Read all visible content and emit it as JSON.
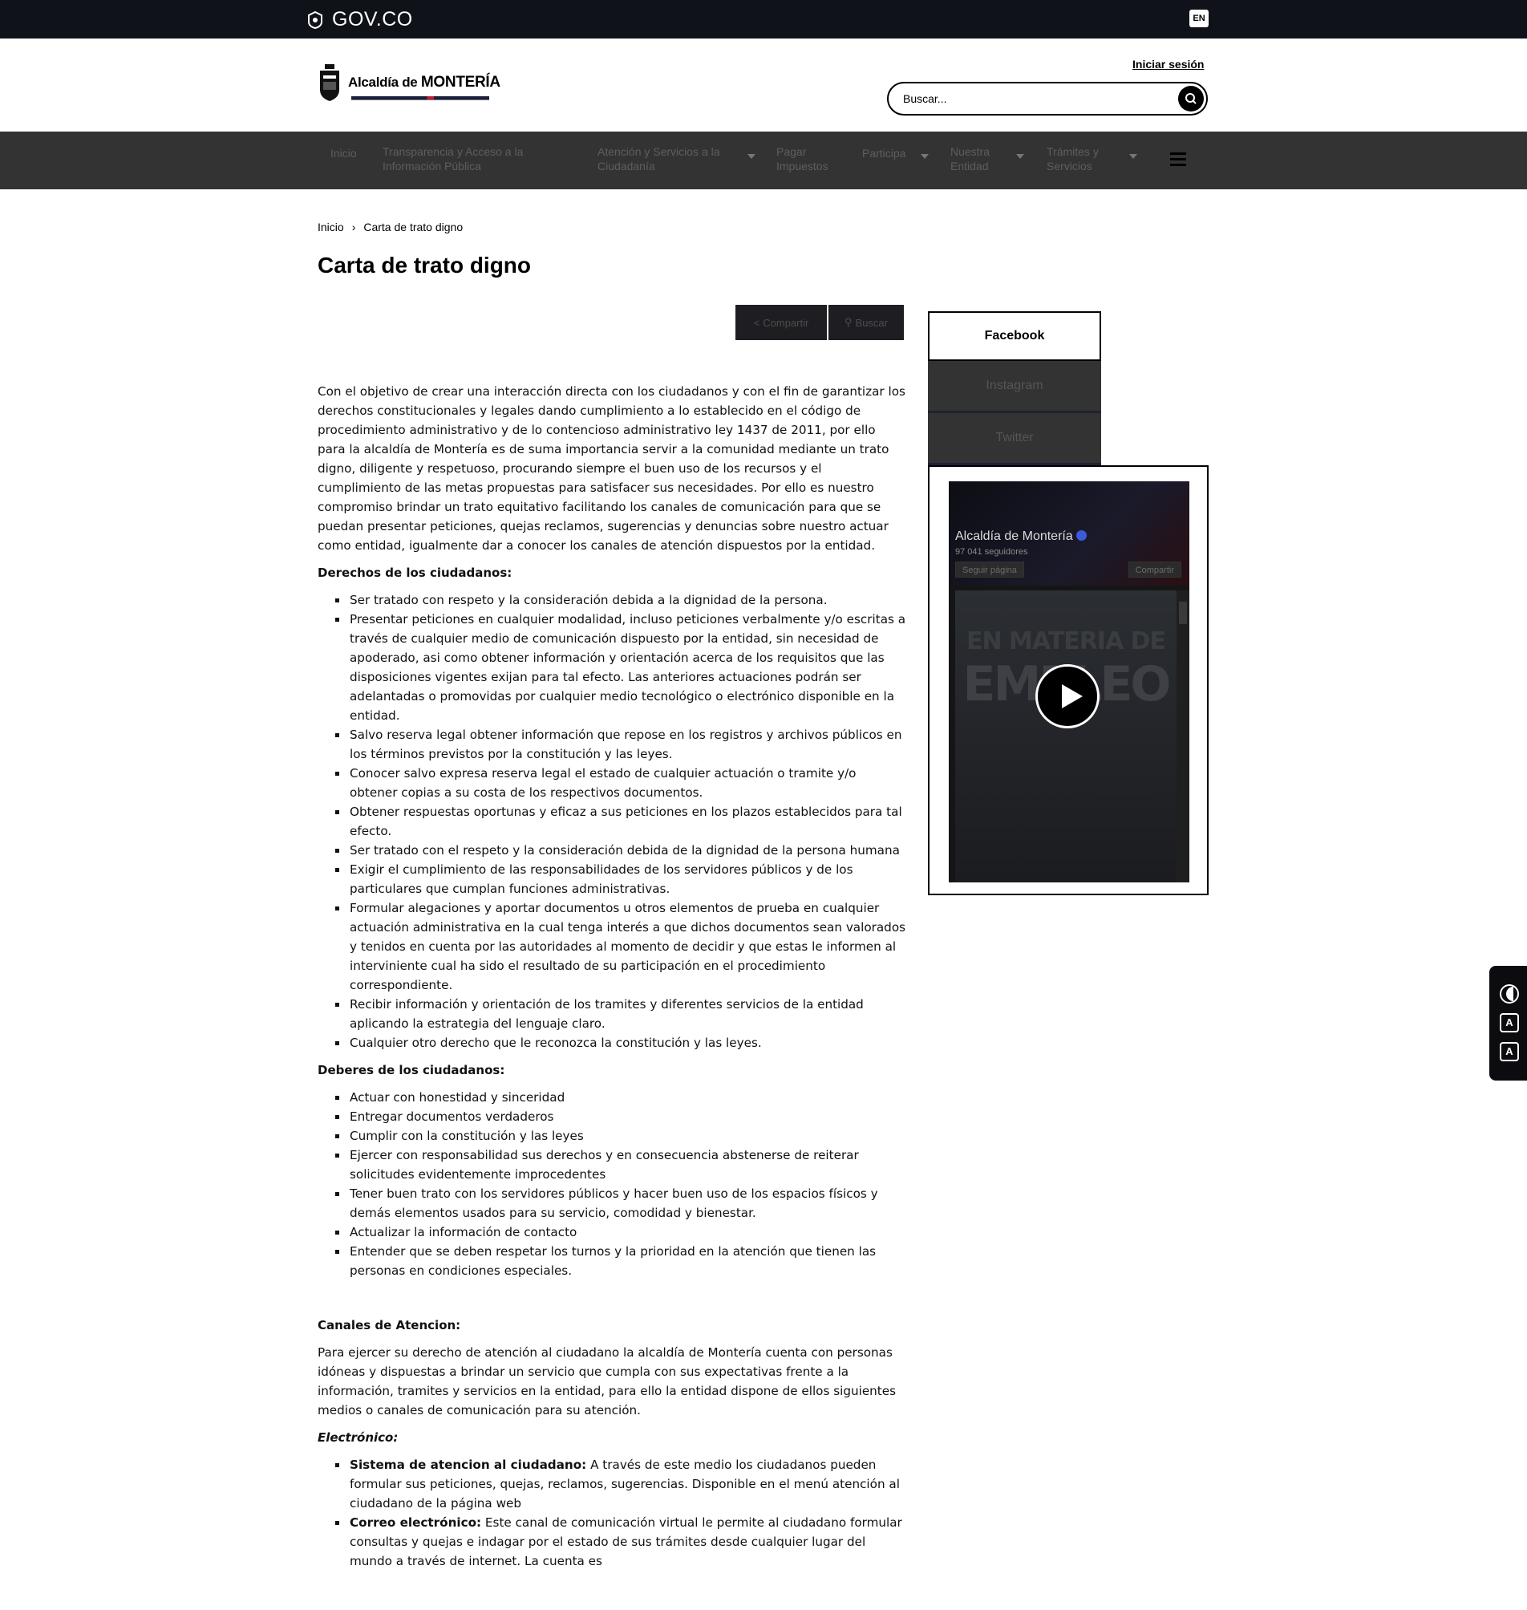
{
  "govbar": {
    "brand": "GOV.CO",
    "lang": "EN"
  },
  "header": {
    "logo_text": "Alcaldía de",
    "logo_city": "MONTERÍA",
    "login": "Iniciar sesión",
    "search_placeholder": "Buscar..."
  },
  "nav": {
    "items": [
      {
        "label": "Inicio"
      },
      {
        "label": "Transparencia y Acceso a la Información Pública"
      },
      {
        "label": "Atención y Servicios a la Ciudadanía"
      },
      {
        "label": "Pagar Impuestos"
      },
      {
        "label": "Participa"
      },
      {
        "label": "Nuestra Entidad"
      },
      {
        "label": "Trámites y Servicios"
      }
    ]
  },
  "breadcrumb": {
    "home": "Inicio",
    "current": "Carta de trato digno"
  },
  "page": {
    "title": "Carta de trato digno",
    "share_label": "Compartir",
    "search_label": "Buscar"
  },
  "article": {
    "intro": "Con el objetivo de crear una interacción directa con los ciudadanos y con el fin de garantizar los derechos constitucionales y legales dando cumplimiento a lo establecido en el código de procedimiento administrativo y de lo contencioso administrativo ley 1437 de 2011, por ello para la alcaldía de Montería es de suma importancia servir a la comunidad mediante un trato digno, diligente y respetuoso, procurando siempre el buen uso de los recursos y el cumplimiento de las metas propuestas para satisfacer sus necesidades. Por ello es nuestro compromiso brindar un trato equitativo facilitando los canales de comunicación para que se puedan presentar peticiones, quejas reclamos, sugerencias y denuncias sobre nuestro actuar como entidad, igualmente dar a conocer los canales de atención dispuestos por la entidad.",
    "rights_heading": "Derechos de los ciudadanos:",
    "rights": [
      "Ser tratado con respeto y la consideración debida a la dignidad de la persona.",
      "Presentar peticiones en cualquier modalidad, incluso peticiones verbalmente y/o escritas a través de cualquier medio de comunicación dispuesto por la entidad, sin necesidad de apoderado, asi como obtener información y orientación acerca de los requisitos que las disposiciones vigentes exijan para tal efecto. Las anteriores actuaciones podrán ser adelantadas o promovidas por cualquier medio tecnológico o electrónico disponible en la entidad.",
      "Salvo reserva legal obtener información que repose en los registros y archivos públicos en los términos previstos por la constitución y las leyes.",
      "Conocer salvo expresa reserva legal el estado de cualquier actuación o tramite y/o obtener copias a su costa de los respectivos documentos.",
      "Obtener respuestas oportunas y eficaz a sus peticiones en los plazos establecidos para tal efecto.",
      "Ser tratado con el respeto y la consideración debida de la dignidad de la persona humana",
      "Exigir el cumplimiento de las responsabilidades de los servidores públicos y de los particulares que cumplan funciones administrativas.",
      "Formular alegaciones y aportar documentos u otros elementos de prueba en cualquier actuación administrativa en la cual tenga interés a que dichos documentos sean valorados y tenidos en cuenta por las autoridades al momento de decidir y que estas le informen al interviniente cual ha sido el resultado de su participación en el procedimiento correspondiente.",
      "Recibir información y orientación de los tramites y diferentes servicios de la entidad aplicando la estrategia del lenguaje claro.",
      "Cualquier otro derecho que le reconozca la constitución y las leyes."
    ],
    "duties_heading": "Deberes de los ciudadanos:",
    "duties": [
      "Actuar con honestidad y sinceridad",
      "Entregar documentos verdaderos",
      "Cumplir con la constitución y las leyes",
      "Ejercer con responsabilidad sus derechos y en consecuencia abstenerse de reiterar solicitudes evidentemente improcedentes",
      "Tener buen trato con los servidores públicos y hacer buen uso de los espacios físicos y demás elementos usados para su servicio, comodidad y bienestar.",
      "Actualizar la información de contacto",
      "Entender que se deben respetar los turnos y la prioridad en la atención que tienen las personas en condiciones especiales."
    ],
    "channels_heading": "Canales de Atencion:",
    "channels_intro": "Para ejercer su derecho de atención al ciudadano la alcaldía de Montería cuenta con personas idóneas y dispuestas a brindar un servicio que cumpla con sus expectativas frente a la información, tramites y servicios en la entidad, para ello la entidad dispone de ellos siguientes medios o canales de comunicación para su atención.",
    "electronic_heading": "Electrónico:",
    "electronic": [
      {
        "label": "Sistema de atencion al ciudadano:",
        "text": " A través de este medio los ciudadanos pueden formular sus peticiones, quejas, reclamos, sugerencias. Disponible en el menú atención al ciudadano de la página web"
      },
      {
        "label": "Correo electrónico:",
        "text": " Este canal de comunicación virtual le permite al ciudadano formular consultas y quejas e indagar por el estado de sus trámites desde cualquier lugar del mundo a través de internet. La cuenta es"
      }
    ]
  },
  "social": {
    "tabs": [
      "Facebook",
      "Instagram",
      "Twitter"
    ],
    "page_name": "Alcaldía de Montería",
    "followers": "97 041 seguidores",
    "follow_label": "Seguir página",
    "share_label": "Compartir",
    "video_text_1": "EN MATERIA DE",
    "video_text_2": "EMPLEO"
  },
  "a11y": {
    "font_down": "A",
    "font_up": "A"
  }
}
